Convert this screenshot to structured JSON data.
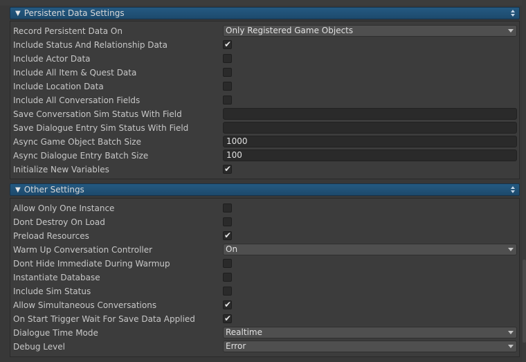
{
  "persistent": {
    "title": "Persistent Data Settings",
    "rows": [
      {
        "label": "Record Persistent Data On",
        "type": "dropdown",
        "value": "Only Registered Game Objects"
      },
      {
        "label": "Include Status And Relationship Data",
        "type": "checkbox",
        "checked": true
      },
      {
        "label": "Include Actor Data",
        "type": "checkbox",
        "checked": false
      },
      {
        "label": "Include All Item & Quest Data",
        "type": "checkbox",
        "checked": false
      },
      {
        "label": "Include Location Data",
        "type": "checkbox",
        "checked": false
      },
      {
        "label": "Include All Conversation Fields",
        "type": "checkbox",
        "checked": false
      },
      {
        "label": "Save Conversation Sim Status With Field",
        "type": "text",
        "value": ""
      },
      {
        "label": "Save Dialogue Entry Sim Status With Field",
        "type": "text",
        "value": ""
      },
      {
        "label": "Async Game Object Batch Size",
        "type": "text",
        "value": "1000"
      },
      {
        "label": "Async Dialogue Entry Batch Size",
        "type": "text",
        "value": "100"
      },
      {
        "label": "Initialize New Variables",
        "type": "checkbox",
        "checked": true
      }
    ]
  },
  "other": {
    "title": "Other Settings",
    "rows": [
      {
        "label": "Allow Only One Instance",
        "type": "checkbox",
        "checked": false
      },
      {
        "label": "Dont Destroy On Load",
        "type": "checkbox",
        "checked": false
      },
      {
        "label": "Preload Resources",
        "type": "checkbox",
        "checked": true
      },
      {
        "label": "Warm Up Conversation Controller",
        "type": "dropdown",
        "value": "On"
      },
      {
        "label": "Dont Hide Immediate During Warmup",
        "type": "checkbox",
        "checked": false
      },
      {
        "label": "Instantiate Database",
        "type": "checkbox",
        "checked": false
      },
      {
        "label": "Include Sim Status",
        "type": "checkbox",
        "checked": false
      },
      {
        "label": "Allow Simultaneous Conversations",
        "type": "checkbox",
        "checked": true
      },
      {
        "label": "On Start Trigger Wait For Save Data Applied",
        "type": "checkbox",
        "checked": true
      },
      {
        "label": "Dialogue Time Mode",
        "type": "dropdown",
        "value": "Realtime"
      },
      {
        "label": "Debug Level",
        "type": "dropdown",
        "value": "Error"
      }
    ]
  },
  "icons": {
    "collapse": "triangle-down-icon",
    "checkmark": "checkmark-icon",
    "dropdown": "dropdown-caret-icon",
    "section_options": "up-down-arrows-icon"
  },
  "colors": {
    "header": "#245a82",
    "background": "#383838",
    "panel": "#3c3c3c",
    "field": "#2a2a2a",
    "dropdown": "#4f4f4f",
    "text": "#c8c8c8"
  }
}
